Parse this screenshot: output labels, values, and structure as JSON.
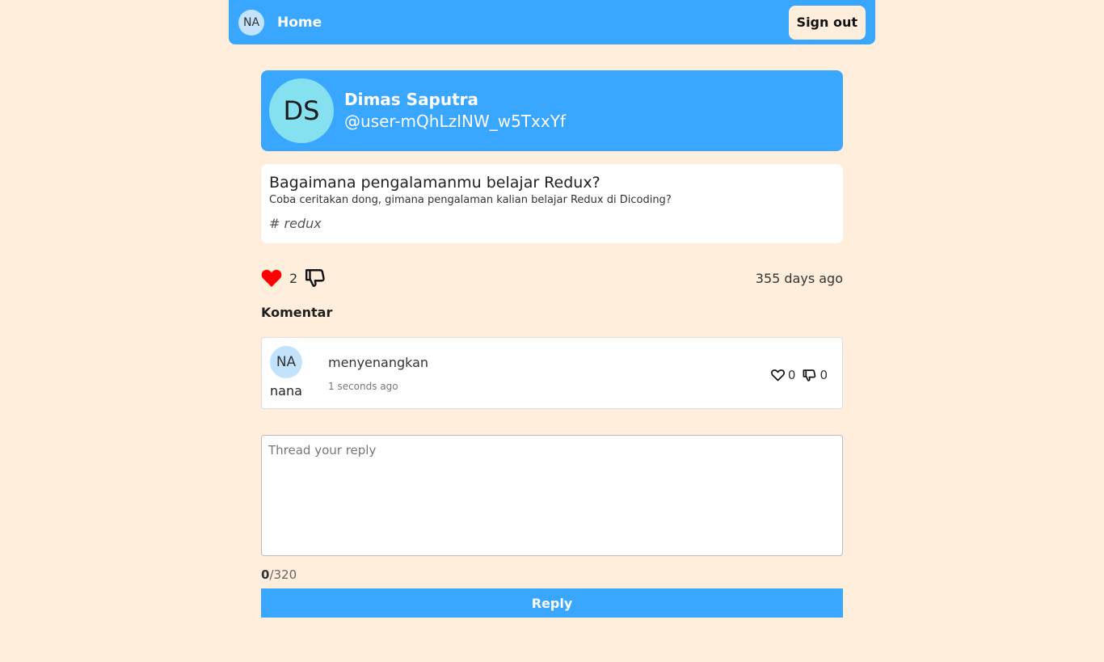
{
  "navbar": {
    "avatar_initials": "NA",
    "home_label": "Home",
    "signout_label": "Sign out",
    "color": "#39a7ff"
  },
  "owner": {
    "initials": "DS",
    "name": "Dimas Saputra",
    "handle": "@user-mQhLzINW_w5TxxYf"
  },
  "thread": {
    "title": "Bagaimana pengalamanmu belajar Redux?",
    "body": "Coba ceritakan dong, gimana pengalaman kalian belajar Redux di Dicoding?",
    "tag": "# redux",
    "likes": "2",
    "time": "355 days ago",
    "liked": true,
    "like_color": "#ff0000"
  },
  "comments": {
    "heading": "Komentar",
    "items": [
      {
        "initials": "NA",
        "author": "nana",
        "content": "menyenangkan",
        "time": "1 seconds ago",
        "up": "0",
        "down": "0"
      }
    ]
  },
  "reply": {
    "placeholder": "Thread your reply",
    "count": "0",
    "max": "/320",
    "button_label": "Reply"
  },
  "page": {
    "background": "#ffeedb"
  }
}
